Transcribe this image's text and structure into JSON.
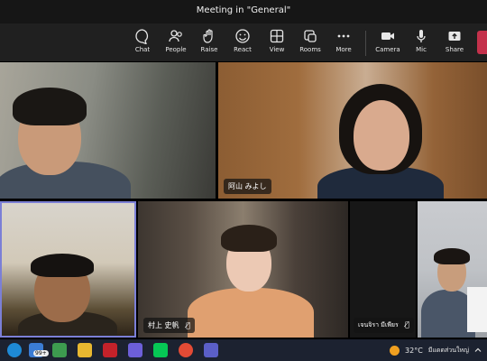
{
  "window": {
    "title": "Meeting in \"General\""
  },
  "toolbar": {
    "buttons": [
      {
        "label": "Chat",
        "icon": "chat-icon"
      },
      {
        "label": "People",
        "icon": "people-icon"
      },
      {
        "label": "Raise",
        "icon": "raise-hand-icon"
      },
      {
        "label": "React",
        "icon": "react-icon"
      },
      {
        "label": "View",
        "icon": "view-icon"
      },
      {
        "label": "Rooms",
        "icon": "rooms-icon"
      },
      {
        "label": "More",
        "icon": "more-icon"
      },
      {
        "label": "Camera",
        "icon": "camera-icon"
      },
      {
        "label": "Mic",
        "icon": "mic-icon"
      },
      {
        "label": "Share",
        "icon": "share-icon"
      }
    ]
  },
  "participants": [
    {
      "name": "",
      "muted": false
    },
    {
      "name": "阿山 みよし",
      "muted": false
    },
    {
      "name": "",
      "muted": false,
      "active_speaker": true
    },
    {
      "name": "村上 史帆",
      "muted": true
    },
    {
      "name": "เจนจิรา มีเพียร",
      "muted": true
    },
    {
      "name": "",
      "muted": false
    }
  ],
  "taskbar": {
    "notification_badge": "99+",
    "temperature": "32°C",
    "weather_text": "มีแดดส่วนใหญ่"
  },
  "colors": {
    "leave": "#c4314b",
    "active_border": "#7b7fd6",
    "taskbar": "#1c2230"
  }
}
